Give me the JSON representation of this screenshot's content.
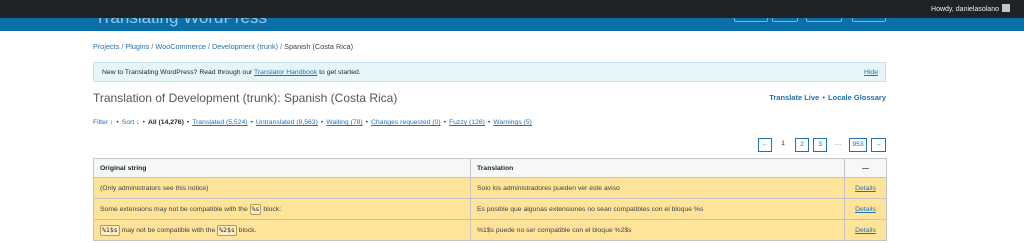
{
  "admin_bar": {
    "howdy": "Howdy, danielasolano"
  },
  "header": {
    "site_title": "Translating WordPress"
  },
  "breadcrumb": {
    "items": [
      "Projects",
      "Plugins",
      "WooCommerce",
      "Development (trunk)",
      "Spanish (Costa Rica)"
    ],
    "separator": "/"
  },
  "notice": {
    "text_before": "New to Translating WordPress? Read through our ",
    "link": "Translator Handbook",
    "text_after": " to get started.",
    "hide": "Hide"
  },
  "page": {
    "title": "Translation of Development (trunk): Spanish (Costa Rica)",
    "translate_live": "Translate Live",
    "dot": "•",
    "locale_glossary": "Locale Glossary"
  },
  "filters": {
    "filter": "Filter ↓",
    "sort": "Sort ↓",
    "bullet": "•",
    "all": "All (14,276)",
    "translated": "Translated (5,524)",
    "untranslated": "Untranslated (8,563)",
    "waiting": "Waiting (78)",
    "changes_requested": "Changes requested (0)",
    "fuzzy": "Fuzzy (126)",
    "warnings": "Warnings (5)"
  },
  "pagination": {
    "prev": "←",
    "current": "1",
    "page2": "2",
    "page3": "3",
    "ellipsis": "…",
    "last": "953",
    "next": "→"
  },
  "table": {
    "headers": {
      "original": "Original string",
      "translation": "Translation",
      "actions": "—"
    },
    "rows": [
      {
        "original_before": "(Only administrators see this notice)",
        "translation": "Solo los administradores pueden ver este aviso",
        "action": "Details"
      },
      {
        "original_before": "Some extensions may not be compatible with the ",
        "placeholder": "%s",
        "original_after": " block:",
        "translation": "Es posible que algunas extensiones no sean compatibles con el bloque %s",
        "action": "Details"
      },
      {
        "placeholder1": "%1$s",
        "original_middle": " may not be compatible with the ",
        "placeholder2": "%2$s",
        "original_after": " block.",
        "translation": "%1$s puede no ser compatible con el bloque %2$s",
        "action": "Details"
      }
    ]
  }
}
